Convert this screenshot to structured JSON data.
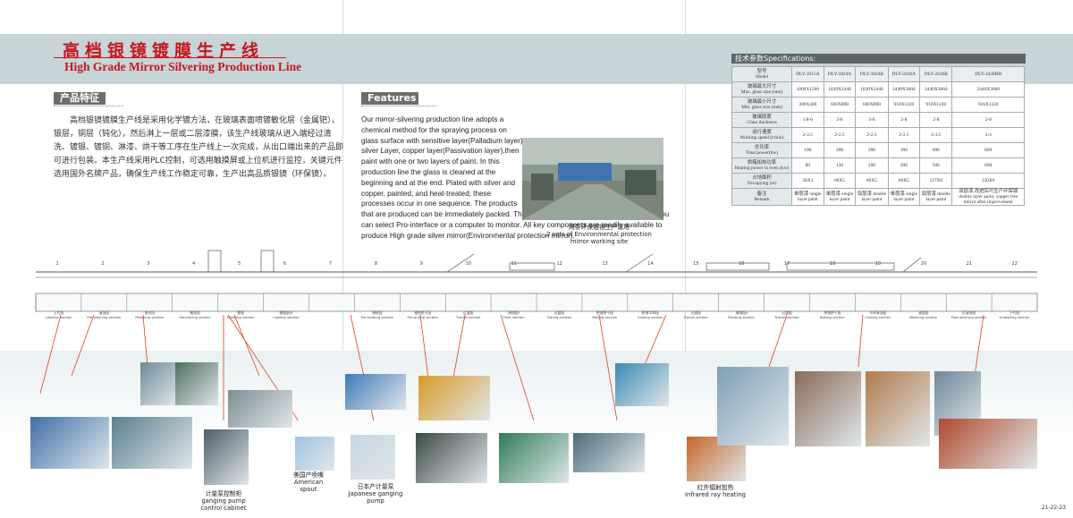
{
  "title": {
    "cn": "高档银镜镀膜生产线",
    "en": "High Grade Mirror Silvering Production Line"
  },
  "cn_section": {
    "heading": "产品特征",
    "body": "　　高档银镜镀膜生产线是采用化学镀方法，在玻璃表面喷镀敏化层（金属钯），银层，铜层（钝化），然后淋上一层或二层漆膜，该生产线玻璃从进入端经过清洗、镀银、镀铜、淋漆、烘干等工序在生产线上一次完成，从出口端出来的产品即可进行包装。本生产线采用PLC控制，可选用触摸屏或上位机进行监控，关键元件选用国外名牌产品，确保生产线工作稳定可靠，生产出高品质银镜（环保镜）。"
  },
  "en_section": {
    "heading": "Features",
    "body": "Our mirror-silvering production line adopts a chemical method for the spraying process on glass surface with sensitive layer(Palladium layer), silver Layer, copper layer(Passivation layer),then paint with one or two layers of paint. In this production line the glass is cleaned at the beginning and at the end. Plated with silver and copper, painted, and heat-treated; these processes occur in one sequence. The products that are produced can be immediately packed. The entire production line is PLC controlled; you can select Pro-interface or a computer to monitor. All key components are readily available to produce High grade silver mirror(Environmental protection mirror)."
  },
  "main_photo": {
    "caption_cn": "两条环保银镜生产现场",
    "caption_en": "2 sets of Environmental protection mirror working site"
  },
  "specs": {
    "heading": "技术参数Specifications:",
    "models_label_cn": "型号",
    "models_label_en": "Model",
    "models": [
      "DLY-1015A",
      "DLY-1824A",
      "DLY-1824B",
      "DLY-2436A",
      "DLY-2436B",
      "DLY-2436BH"
    ],
    "rows": [
      {
        "cn": "玻璃最大尺寸",
        "en": "Max. glass size (mm)",
        "values": [
          "1000X1500",
          "1830X2440",
          "1830X2440",
          "2440X3660",
          "2440X3660",
          "2440X3660"
        ]
      },
      {
        "cn": "玻璃最小尺寸",
        "en": "Min. glass size (mm)",
        "values": [
          "300X400",
          "600X800",
          "600X800",
          "916X1220",
          "916X1220",
          "916X1220"
        ]
      },
      {
        "cn": "玻璃厚度",
        "en": "Glass thickness",
        "values": [
          "1.8-6",
          "3-8",
          "3-8",
          "2-8",
          "2-8",
          "2-8"
        ]
      },
      {
        "cn": "运行速度",
        "en": "Working speed (r/min)",
        "values": [
          "2-2.5",
          "2-2.5",
          "2-2.5",
          "2-2.5",
          "2-3.5",
          "3-4"
        ]
      },
      {
        "cn": "总功率",
        "en": "Total power(kw)",
        "values": [
          "100",
          "208",
          "300",
          "300",
          "600",
          "800"
        ]
      },
      {
        "cn": "烘箱加热功率",
        "en": "Heating power in oven (kw)",
        "values": [
          "80",
          "130",
          "200",
          "200",
          "500",
          "600"
        ]
      },
      {
        "cn": "占地面积",
        "en": "Occupying (m)",
        "values": [
          "58X3",
          "60X5",
          "80X5",
          "80X5",
          "127X6",
          "156X6"
        ]
      },
      {
        "cn": "备注",
        "en": "Remark",
        "values": [
          "单层漆 single layer paint",
          "单层漆 single layer paint",
          "双层漆 double layer paint",
          "单层漆 single layer paint",
          "双层漆 double layer paint",
          "双层漆,改进后可生产环保镜 double layer paint, copper free mirror after improvement"
        ]
      }
    ]
  },
  "process_line": {
    "sections": [
      {
        "num": "1",
        "cn": "上片段",
        "en": "Loading section"
      },
      {
        "num": "2",
        "cn": "清洗段",
        "en": "Pre-washing section"
      },
      {
        "num": "3",
        "cn": "抛光段",
        "en": "Polishing section"
      },
      {
        "num": "4",
        "cn": "敏化段",
        "en": "Sensitizing section"
      },
      {
        "num": "5",
        "cn": "镀银",
        "en": "Silvering section"
      },
      {
        "num": "6",
        "cn": "镀银部分",
        "en": "Coating section"
      },
      {
        "num": "7",
        "cn": "",
        "en": ""
      },
      {
        "num": "8",
        "cn": "预热段",
        "en": "Pre-heating section"
      },
      {
        "num": "9",
        "cn": "预热烘干段",
        "en": "Pre-drying section"
      },
      {
        "num": "10",
        "cn": "过渡段",
        "en": "Transit section"
      },
      {
        "num": "11",
        "cn": "淋漆段Ⅰ",
        "en": "Paint section"
      },
      {
        "num": "12",
        "cn": "过渡段",
        "en": "Transit section"
      },
      {
        "num": "13",
        "cn": "烘漆烘干段",
        "en": "Baking section"
      },
      {
        "num": "14",
        "cn": "烘漆冷却段",
        "en": "Cooling section"
      },
      {
        "num": "15",
        "cn": "过渡段",
        "en": "Transit section"
      },
      {
        "num": "16",
        "cn": "淋漆段Ⅱ",
        "en": "Painting section"
      },
      {
        "num": "17",
        "cn": "过渡段",
        "en": "Transit section"
      },
      {
        "num": "18",
        "cn": "烘漆烘干段",
        "en": "Baking section"
      },
      {
        "num": "19",
        "cn": "冷却清洗段",
        "en": "Cooling section"
      },
      {
        "num": "20",
        "cn": "清洗段",
        "en": "Washing section"
      },
      {
        "num": "21",
        "cn": "后清洗段",
        "en": "Post-washing section"
      },
      {
        "num": "22",
        "cn": "下片段",
        "en": "Unloading section"
      }
    ]
  },
  "photo_captions": {
    "cabinet_cn": "计量泵控制柜",
    "cabinet_en": "ganging pump control cabinet",
    "spout_cn": "美国产喷嘴",
    "spout_en": "American spout",
    "pump_cn": "日本产计量泵",
    "pump_en": "Japanese ganging pump",
    "infrared_cn": "红外辐射加热",
    "infrared_en": "Infrared ray heating"
  },
  "page_number": "21-22-23",
  "colors": {
    "accent": "#c4171c",
    "band": "#c7d4d8",
    "arrow": "#e0401c"
  }
}
